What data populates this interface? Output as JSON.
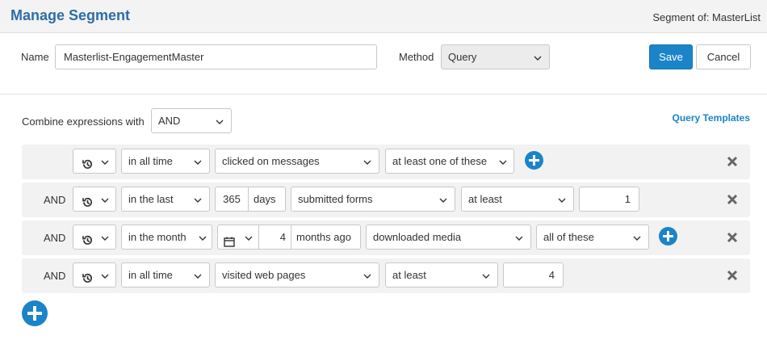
{
  "header": {
    "title": "Manage Segment",
    "segment_of": "Segment of: MasterList"
  },
  "form": {
    "name_label": "Name",
    "name_value": "Masterlist-EngagementMaster",
    "method_label": "Method",
    "method_value": "Query",
    "save_label": "Save",
    "cancel_label": "Cancel"
  },
  "builder": {
    "combine_label": "Combine expressions with",
    "combine_value": "AND",
    "query_templates": "Query Templates",
    "rows": [
      {
        "op": "",
        "time": "in all time",
        "action": "clicked on messages",
        "qualifier": "at least one of these"
      },
      {
        "op": "AND",
        "time": "in the last",
        "num": "365",
        "unit": "days",
        "action": "submitted forms",
        "qualifier": "at least",
        "count": "1"
      },
      {
        "op": "AND",
        "time": "in the month",
        "num": "4",
        "unit": "months ago",
        "action": "downloaded media",
        "qualifier": "all of these"
      },
      {
        "op": "AND",
        "time": "in all time",
        "action": "visited web pages",
        "qualifier": "at least",
        "count": "4"
      }
    ]
  },
  "icons": {
    "history": "history-icon",
    "calendar": "calendar-icon",
    "add": "plus-circle-icon",
    "remove": "x-icon",
    "dropdown": "chevron-down-icon"
  },
  "colors": {
    "accent": "#1b84c8",
    "title": "#2f6da8",
    "row_bg": "#f2f2f2"
  }
}
